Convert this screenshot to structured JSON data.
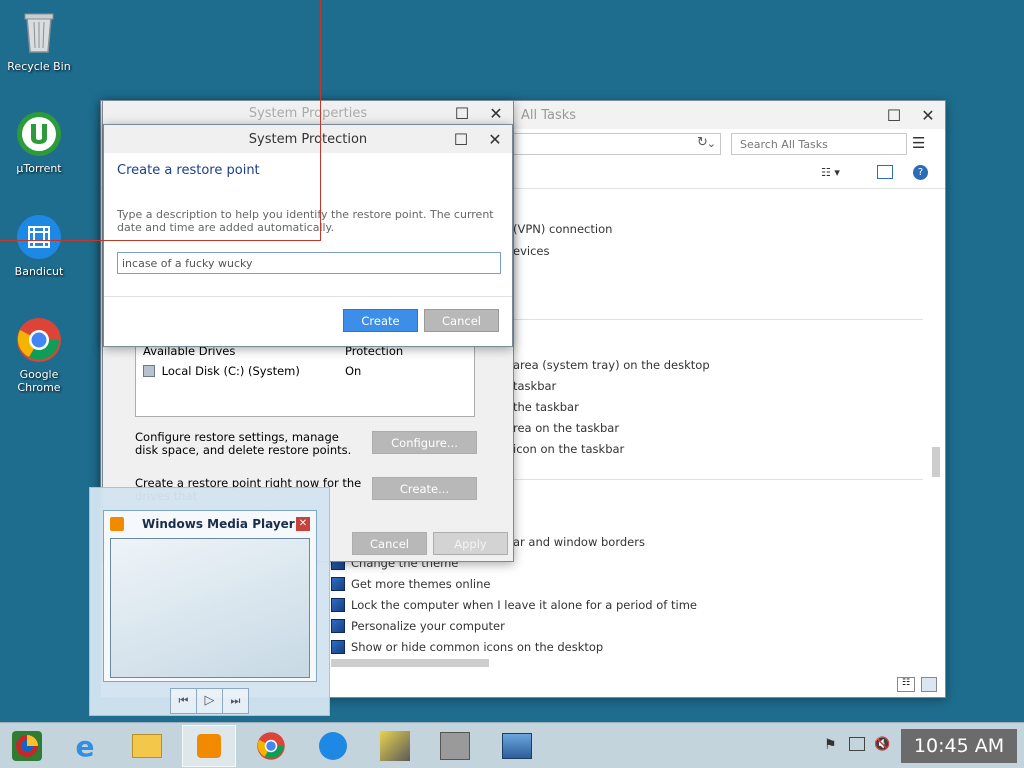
{
  "desktop": {
    "icons": [
      {
        "label": "Recycle Bin"
      },
      {
        "label": "µTorrent"
      },
      {
        "label": "Bandicut"
      },
      {
        "label": "Google Chrome"
      }
    ]
  },
  "control_panel": {
    "title": "All Tasks",
    "search_placeholder": "Search All Tasks",
    "items_top": [
      "(VPN) connection",
      "evices"
    ],
    "items_mid": [
      "area (system tray) on the desktop",
      "taskbar",
      "the taskbar",
      "rea on the taskbar",
      "icon on the taskbar"
    ],
    "items_bottom_partial": "ar and window borders",
    "tasks": [
      "Change the theme",
      "Get more themes online",
      "Lock the computer when I leave it alone for a period of time",
      "Personalize your computer",
      "Show or hide common icons on the desktop"
    ]
  },
  "system_properties": {
    "title": "System Properties",
    "drives_header": {
      "col1": "Available Drives",
      "col2": "Protection"
    },
    "drive_row": {
      "name": "Local Disk (C:) (System)",
      "protection": "On"
    },
    "configure_text": "Configure restore settings, manage disk space, and delete restore points.",
    "configure_label": "Configure...",
    "create_text": "Create a restore point right now for the drives that",
    "create_label": "Create...",
    "cancel_label": "Cancel",
    "apply_label": "Apply"
  },
  "protection_dialog": {
    "title": "System Protection",
    "heading": "Create a restore point",
    "description": "Type a description to help you identify the restore point. The current date and time are added automatically.",
    "input_value": "incase of a fucky wucky",
    "create_label": "Create",
    "cancel_label": "Cancel"
  },
  "wmp_preview": {
    "title": "Windows Media Player"
  },
  "taskbar": {
    "clock": "10:45 AM"
  },
  "colors": {
    "desktop": "#1e6d8f",
    "accent_button": "#3c8ee9",
    "heading_blue": "#1b3f8a"
  }
}
